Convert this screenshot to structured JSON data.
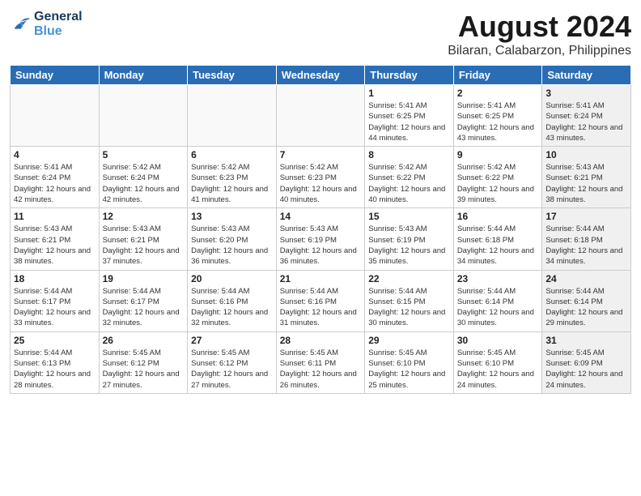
{
  "logo": {
    "general": "General",
    "blue": "Blue"
  },
  "header": {
    "title": "August 2024",
    "subtitle": "Bilaran, Calabarzon, Philippines"
  },
  "weekdays": [
    "Sunday",
    "Monday",
    "Tuesday",
    "Wednesday",
    "Thursday",
    "Friday",
    "Saturday"
  ],
  "weeks": [
    [
      {
        "day": "",
        "empty": true
      },
      {
        "day": "",
        "empty": true
      },
      {
        "day": "",
        "empty": true
      },
      {
        "day": "",
        "empty": true
      },
      {
        "day": "1",
        "sunrise": "Sunrise: 5:41 AM",
        "sunset": "Sunset: 6:25 PM",
        "daylight": "Daylight: 12 hours and 44 minutes."
      },
      {
        "day": "2",
        "sunrise": "Sunrise: 5:41 AM",
        "sunset": "Sunset: 6:25 PM",
        "daylight": "Daylight: 12 hours and 43 minutes."
      },
      {
        "day": "3",
        "sunrise": "Sunrise: 5:41 AM",
        "sunset": "Sunset: 6:24 PM",
        "daylight": "Daylight: 12 hours and 43 minutes.",
        "shaded": true
      }
    ],
    [
      {
        "day": "4",
        "sunrise": "Sunrise: 5:41 AM",
        "sunset": "Sunset: 6:24 PM",
        "daylight": "Daylight: 12 hours and 42 minutes."
      },
      {
        "day": "5",
        "sunrise": "Sunrise: 5:42 AM",
        "sunset": "Sunset: 6:24 PM",
        "daylight": "Daylight: 12 hours and 42 minutes."
      },
      {
        "day": "6",
        "sunrise": "Sunrise: 5:42 AM",
        "sunset": "Sunset: 6:23 PM",
        "daylight": "Daylight: 12 hours and 41 minutes."
      },
      {
        "day": "7",
        "sunrise": "Sunrise: 5:42 AM",
        "sunset": "Sunset: 6:23 PM",
        "daylight": "Daylight: 12 hours and 40 minutes."
      },
      {
        "day": "8",
        "sunrise": "Sunrise: 5:42 AM",
        "sunset": "Sunset: 6:22 PM",
        "daylight": "Daylight: 12 hours and 40 minutes."
      },
      {
        "day": "9",
        "sunrise": "Sunrise: 5:42 AM",
        "sunset": "Sunset: 6:22 PM",
        "daylight": "Daylight: 12 hours and 39 minutes."
      },
      {
        "day": "10",
        "sunrise": "Sunrise: 5:43 AM",
        "sunset": "Sunset: 6:21 PM",
        "daylight": "Daylight: 12 hours and 38 minutes.",
        "shaded": true
      }
    ],
    [
      {
        "day": "11",
        "sunrise": "Sunrise: 5:43 AM",
        "sunset": "Sunset: 6:21 PM",
        "daylight": "Daylight: 12 hours and 38 minutes."
      },
      {
        "day": "12",
        "sunrise": "Sunrise: 5:43 AM",
        "sunset": "Sunset: 6:21 PM",
        "daylight": "Daylight: 12 hours and 37 minutes."
      },
      {
        "day": "13",
        "sunrise": "Sunrise: 5:43 AM",
        "sunset": "Sunset: 6:20 PM",
        "daylight": "Daylight: 12 hours and 36 minutes."
      },
      {
        "day": "14",
        "sunrise": "Sunrise: 5:43 AM",
        "sunset": "Sunset: 6:19 PM",
        "daylight": "Daylight: 12 hours and 36 minutes."
      },
      {
        "day": "15",
        "sunrise": "Sunrise: 5:43 AM",
        "sunset": "Sunset: 6:19 PM",
        "daylight": "Daylight: 12 hours and 35 minutes."
      },
      {
        "day": "16",
        "sunrise": "Sunrise: 5:44 AM",
        "sunset": "Sunset: 6:18 PM",
        "daylight": "Daylight: 12 hours and 34 minutes."
      },
      {
        "day": "17",
        "sunrise": "Sunrise: 5:44 AM",
        "sunset": "Sunset: 6:18 PM",
        "daylight": "Daylight: 12 hours and 34 minutes.",
        "shaded": true
      }
    ],
    [
      {
        "day": "18",
        "sunrise": "Sunrise: 5:44 AM",
        "sunset": "Sunset: 6:17 PM",
        "daylight": "Daylight: 12 hours and 33 minutes."
      },
      {
        "day": "19",
        "sunrise": "Sunrise: 5:44 AM",
        "sunset": "Sunset: 6:17 PM",
        "daylight": "Daylight: 12 hours and 32 minutes."
      },
      {
        "day": "20",
        "sunrise": "Sunrise: 5:44 AM",
        "sunset": "Sunset: 6:16 PM",
        "daylight": "Daylight: 12 hours and 32 minutes."
      },
      {
        "day": "21",
        "sunrise": "Sunrise: 5:44 AM",
        "sunset": "Sunset: 6:16 PM",
        "daylight": "Daylight: 12 hours and 31 minutes."
      },
      {
        "day": "22",
        "sunrise": "Sunrise: 5:44 AM",
        "sunset": "Sunset: 6:15 PM",
        "daylight": "Daylight: 12 hours and 30 minutes."
      },
      {
        "day": "23",
        "sunrise": "Sunrise: 5:44 AM",
        "sunset": "Sunset: 6:14 PM",
        "daylight": "Daylight: 12 hours and 30 minutes."
      },
      {
        "day": "24",
        "sunrise": "Sunrise: 5:44 AM",
        "sunset": "Sunset: 6:14 PM",
        "daylight": "Daylight: 12 hours and 29 minutes.",
        "shaded": true
      }
    ],
    [
      {
        "day": "25",
        "sunrise": "Sunrise: 5:44 AM",
        "sunset": "Sunset: 6:13 PM",
        "daylight": "Daylight: 12 hours and 28 minutes."
      },
      {
        "day": "26",
        "sunrise": "Sunrise: 5:45 AM",
        "sunset": "Sunset: 6:12 PM",
        "daylight": "Daylight: 12 hours and 27 minutes."
      },
      {
        "day": "27",
        "sunrise": "Sunrise: 5:45 AM",
        "sunset": "Sunset: 6:12 PM",
        "daylight": "Daylight: 12 hours and 27 minutes."
      },
      {
        "day": "28",
        "sunrise": "Sunrise: 5:45 AM",
        "sunset": "Sunset: 6:11 PM",
        "daylight": "Daylight: 12 hours and 26 minutes."
      },
      {
        "day": "29",
        "sunrise": "Sunrise: 5:45 AM",
        "sunset": "Sunset: 6:10 PM",
        "daylight": "Daylight: 12 hours and 25 minutes."
      },
      {
        "day": "30",
        "sunrise": "Sunrise: 5:45 AM",
        "sunset": "Sunset: 6:10 PM",
        "daylight": "Daylight: 12 hours and 24 minutes."
      },
      {
        "day": "31",
        "sunrise": "Sunrise: 5:45 AM",
        "sunset": "Sunset: 6:09 PM",
        "daylight": "Daylight: 12 hours and 24 minutes.",
        "shaded": true
      }
    ]
  ]
}
